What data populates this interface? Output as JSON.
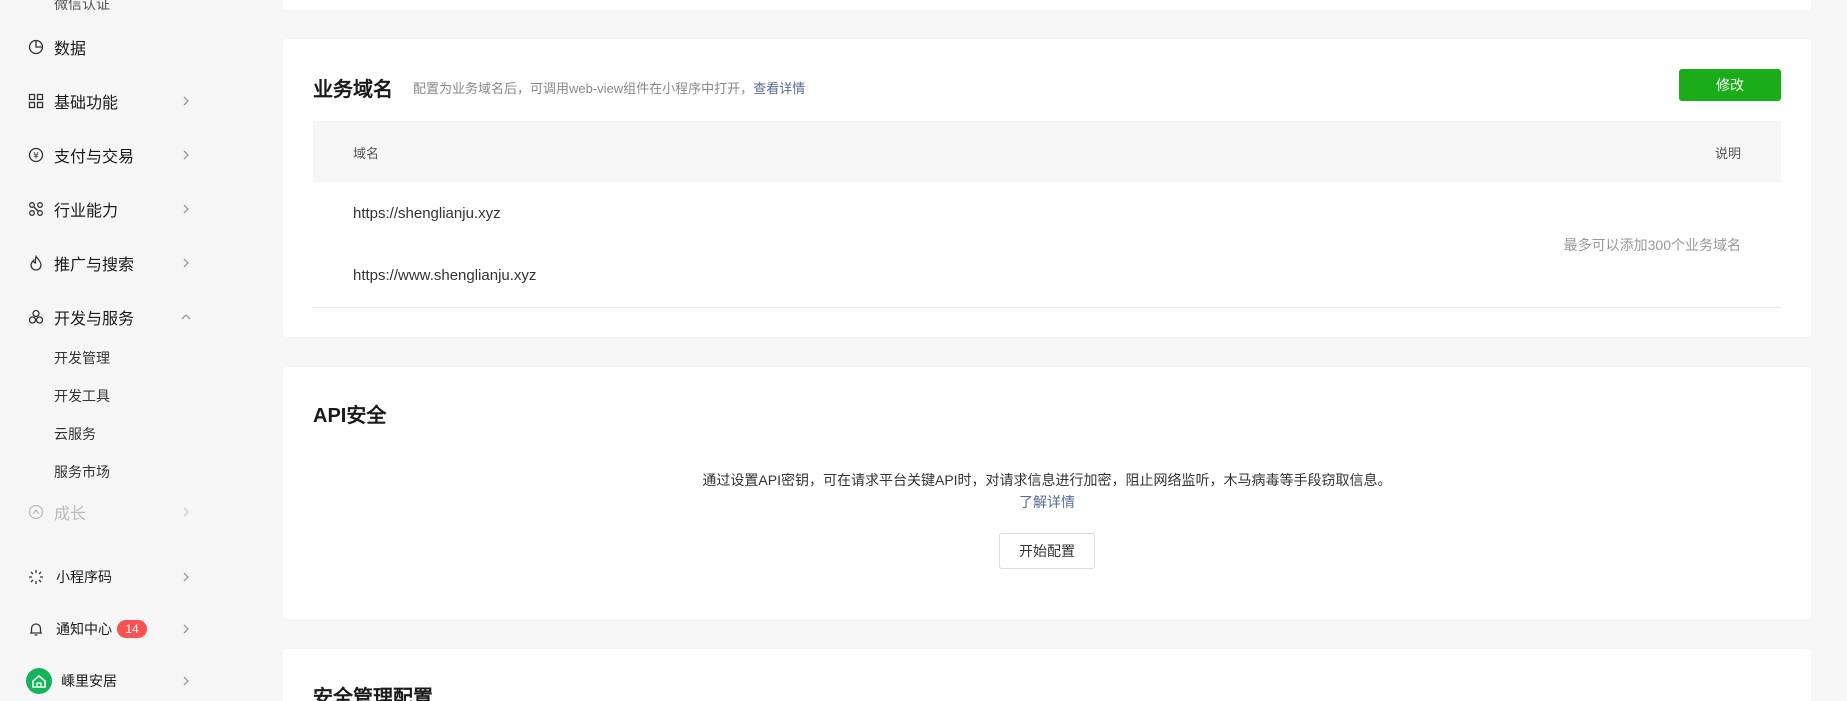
{
  "sidebar": {
    "partial_top_item": "微信认证",
    "items": [
      {
        "label": "数据"
      },
      {
        "label": "基础功能"
      },
      {
        "label": "支付与交易"
      },
      {
        "label": "行业能力"
      },
      {
        "label": "推广与搜索"
      },
      {
        "label": "开发与服务"
      },
      {
        "label": "成长"
      }
    ],
    "dev_sub_items": [
      "开发管理",
      "开发工具",
      "云服务",
      "服务市场"
    ],
    "bottom": {
      "miniprogram_code": "小程序码",
      "notifications": "通知中心",
      "notification_count": "14",
      "account_name": "嵊里安居"
    }
  },
  "domain_card": {
    "title": "业务域名",
    "desc": "配置为业务域名后，可调用web-view组件在小程序中打开，",
    "desc_link": "查看详情",
    "edit_button": "修改",
    "col_domain": "域名",
    "col_note": "说明",
    "domains": [
      "https://shenglianju.xyz",
      "https://www.shenglianju.xyz"
    ],
    "note": "最多可以添加300个业务域名"
  },
  "api_card": {
    "title": "API安全",
    "desc": "通过设置API密钥，可在请求平台关键API时，对请求信息进行加密，阻止网络监听，木马病毒等手段窃取信息。",
    "link": "了解详情",
    "button": "开始配置"
  },
  "security_card": {
    "title": "安全管理配置"
  },
  "colors": {
    "primary_green": "#1aad19",
    "link_blue": "#576b95",
    "badge_red": "#fa5151",
    "avatar_green": "#15b35b"
  }
}
